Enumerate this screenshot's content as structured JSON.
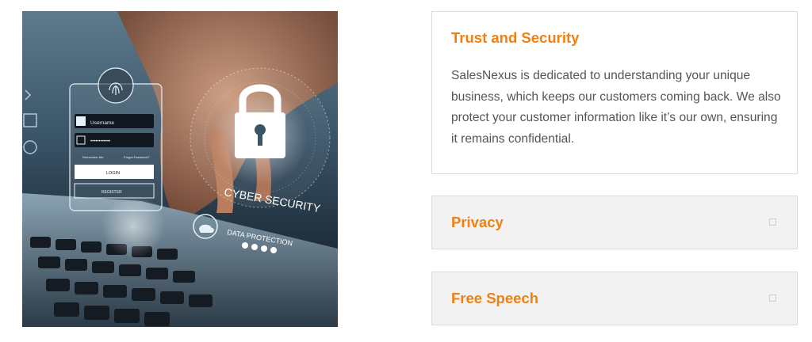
{
  "hero_image": {
    "username_placeholder": "Username",
    "password_mask": "••••••••••••",
    "remember_label": "Remember Me",
    "forgot_label": "Forgot Password?",
    "login_label": "LOGIN",
    "register_label": "REGISTER",
    "cyber_security_label": "CYBER SECURITY",
    "data_protection_label": "DATA PROTECTION"
  },
  "accordion": {
    "items": [
      {
        "title": "Trust and Security",
        "expanded": true,
        "body": "SalesNexus is dedicated to understanding your unique business, which keeps our customers coming back. We also protect your customer information like it’s our own, ensuring it remains confidential."
      },
      {
        "title": "Privacy",
        "expanded": false
      },
      {
        "title": "Free Speech",
        "expanded": false
      }
    ]
  },
  "colors": {
    "accent": "#f08010",
    "body_text": "#555555",
    "closed_panel_bg": "#f2f2f2",
    "border": "#dcdcdc"
  }
}
